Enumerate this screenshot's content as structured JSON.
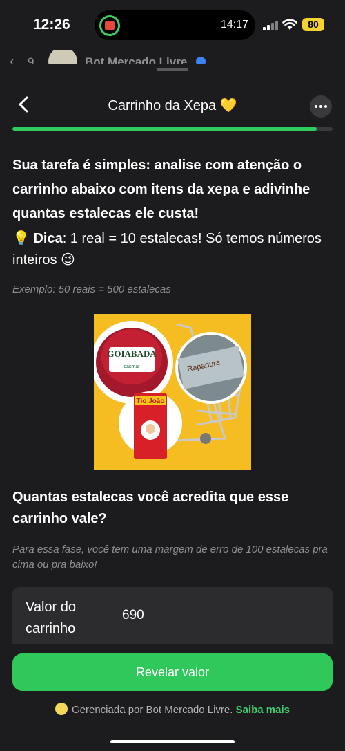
{
  "status_bar": {
    "time": "12:26",
    "live_activity_time": "14:17",
    "battery": "80"
  },
  "background_chat": {
    "back_count": "9",
    "name": "Bot Mercado Livre"
  },
  "sheet": {
    "title": "Carrinho da Xepa 💛",
    "progress": 0.95,
    "intro": "Sua tarefa é simples: analise com atenção o carrinho abaixo com itens da xepa e adivinhe quantas estalecas ele custa!",
    "tip_icon": "💡",
    "tip_label": "Dica",
    "tip_text": ": 1 real = 10 estalecas! Só temos números inteiros 😉",
    "example": "Exemplo: 50 reais = 500 estalecas",
    "image_labels": {
      "product_1": "GOIABADA",
      "product_1_brand": "casmar",
      "product_2": "Rapadura",
      "product_3": "Tio João"
    },
    "question": "Quantas estalecas você acredita que esse carrinho vale?",
    "margin_note": "Para essa fase, você tem uma margem de erro de 100 estalecas pra cima ou pra baixo!",
    "value_label": "Valor do carrinho",
    "value": "690",
    "reveal_button": "Revelar valor",
    "footer_text": "Gerenciada por Bot Mercado Livre.",
    "footer_link": "Saiba mais"
  },
  "colors": {
    "accent_green": "#2fc95b",
    "background": "#1c1c1e",
    "image_background": "#f5bd22"
  }
}
